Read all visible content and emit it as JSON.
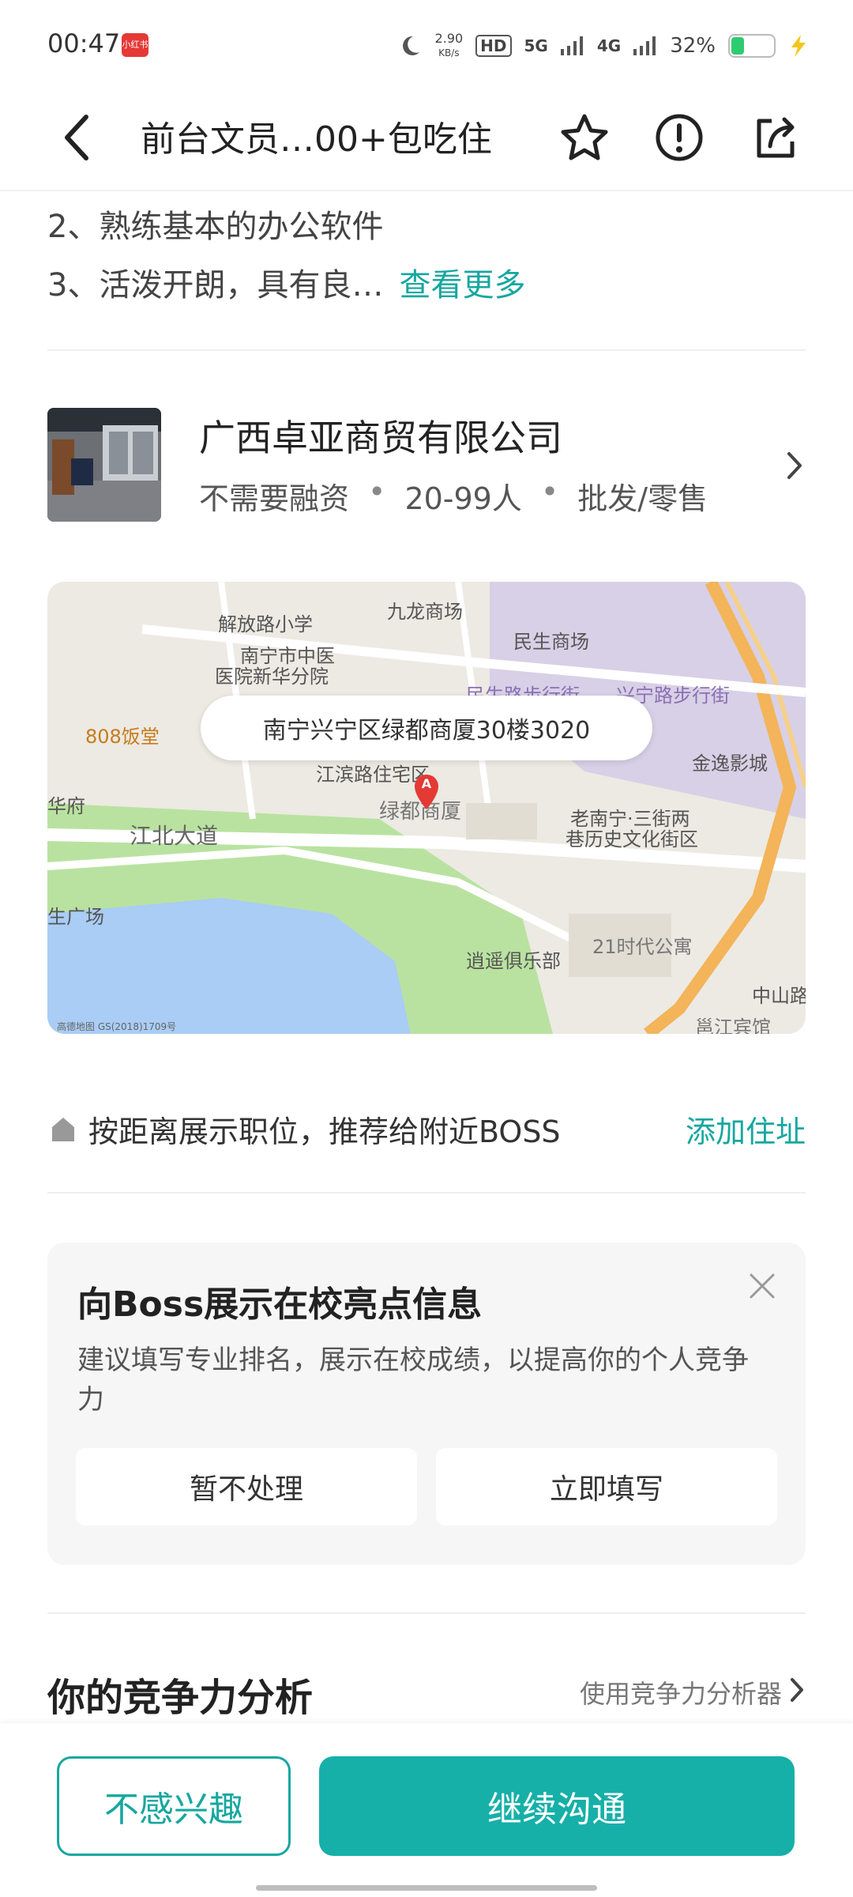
{
  "status_bar": {
    "time": "00:47",
    "badge": "小红书",
    "net_speed_value": "2.90",
    "net_speed_unit": "KB/s",
    "hd_label": "HD",
    "signal_5g": "5G",
    "signal_4g": "4G",
    "battery": "32%",
    "battery_level": 0.32,
    "icons": [
      "moon-icon",
      "signal-icon",
      "battery-icon",
      "charging-icon"
    ]
  },
  "header": {
    "title": "前台文员…00+包吃住",
    "icons": [
      "back-icon",
      "star-icon",
      "warning-icon",
      "share-icon"
    ]
  },
  "description": {
    "line2": "2、熟练基本的办公软件",
    "line3": "3、活泼开朗，具有良…",
    "more": "查看更多"
  },
  "company": {
    "name": "广西卓亚商贸有限公司",
    "financing": "不需要融资",
    "size": "20-99人",
    "industry": "批发/零售",
    "dot": "•"
  },
  "map": {
    "address": "南宁兴宁区绿都商厦30楼3020",
    "pin_label": "A",
    "labels": {
      "l1": "解放路小学",
      "l2": "九龙商场",
      "l3": "民生商场",
      "l4": "南宁市中医",
      "l5": "医院新华分院",
      "l6": "808饭堂",
      "l7": "金逸影城",
      "l8": "江滨路住宅区",
      "l9": "绿都商厦",
      "l10": "老南宁·三街两",
      "l11": "巷历史文化街区",
      "l12": "江北大道",
      "l13": "华府",
      "l14": "生广场",
      "l15": "逍遥俱乐部",
      "l16": "21时代公寓",
      "l17": "中山路",
      "l18": "邕江宾馆",
      "l19": "民生路步行街",
      "l20": "兴宁路步行街",
      "attribution": "高德地图 GS(2018)1709号"
    },
    "colors": {
      "land": "#eceae3",
      "water": "#a9cdf5",
      "park": "#b9e2a0",
      "road_main": "#f3b45a"
    }
  },
  "location": {
    "text": "按距离展示职位，推荐给附近BOSS",
    "link": "添加住址"
  },
  "promo": {
    "title": "向Boss展示在校亮点信息",
    "body": "建议填写专业排名，展示在校成绩，以提高你的个人竞争力",
    "skip": "暂不处理",
    "fill": "立即填写"
  },
  "analysis": {
    "title": "你的竞争力分析",
    "link": "使用竞争力分析器"
  },
  "bottom": {
    "not_interested": "不感兴趣",
    "continue_chat": "继续沟通"
  },
  "colors": {
    "accent": "#16a7a0",
    "primary_button": "#16b0a8",
    "map_pin": "#e53935"
  }
}
